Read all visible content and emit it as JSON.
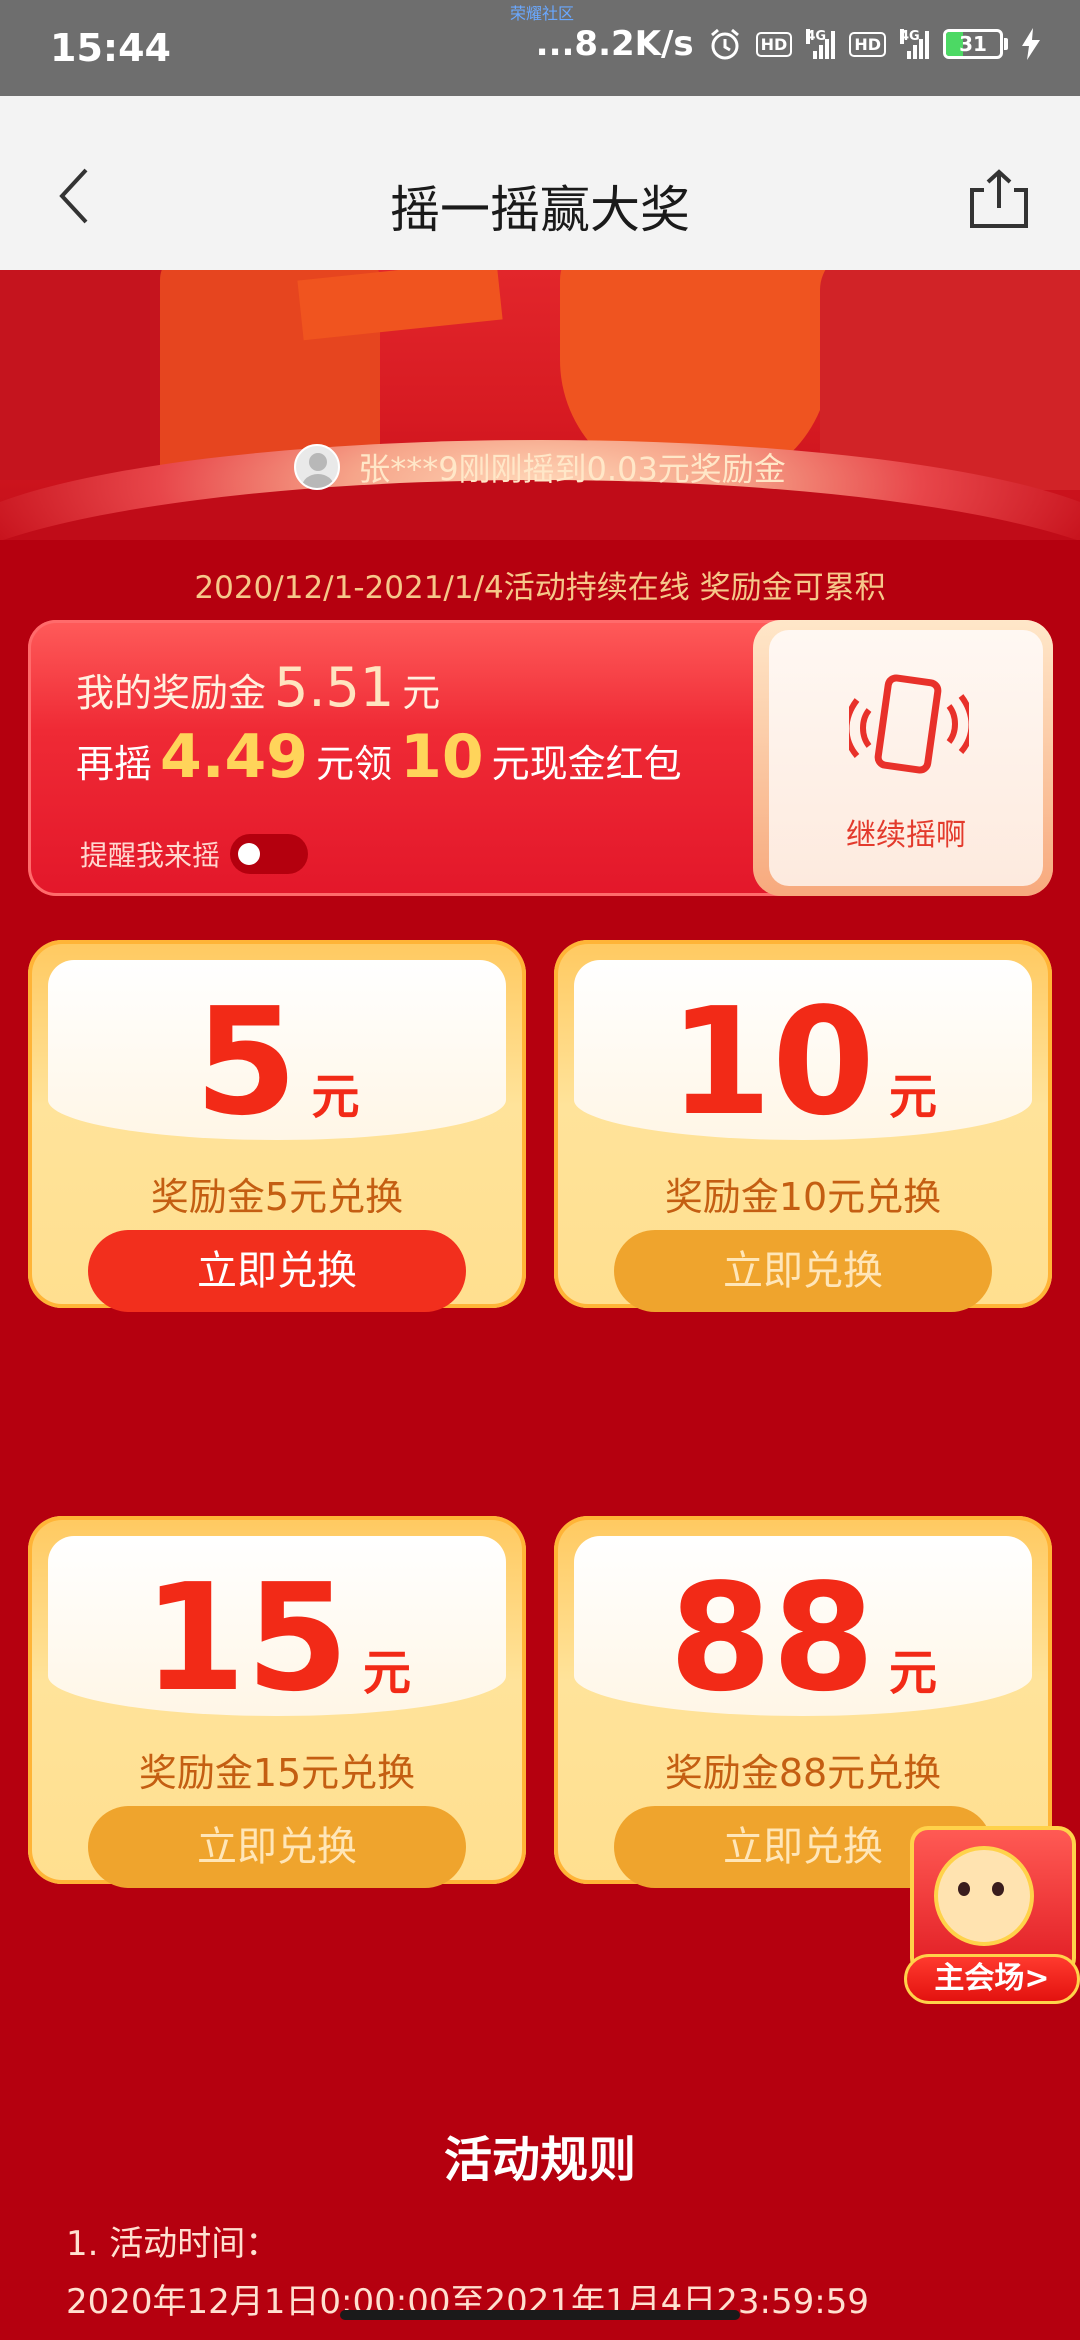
{
  "status_bar": {
    "time": "15:44",
    "tiny_label": "荣耀社区",
    "net_speed": "...8.2K/s",
    "network1": "4G",
    "network2": "4G",
    "hd_label": "HD",
    "battery": "31"
  },
  "header": {
    "title": "摇一摇赢大奖"
  },
  "banner": {
    "winner_text": "张***9刚刚摇到0.03元奖励金"
  },
  "period_text": "2020/12/1-2021/1/4活动持续在线 奖励金可累积",
  "reward": {
    "my_label": "我的奖励金",
    "my_amount": "5.51",
    "my_unit": "元",
    "more_prefix": "再摇",
    "more_amount": "4.49",
    "more_middle": "元领",
    "target_amount": "10",
    "more_suffix": "元现金红包",
    "remind_label": "提醒我来摇",
    "continue_label": "继续摇啊"
  },
  "cards": [
    {
      "amount": "5",
      "unit": "元",
      "desc": "奖励金5元兑换",
      "button": "立即兑换",
      "active": true
    },
    {
      "amount": "10",
      "unit": "元",
      "desc": "奖励金10元兑换",
      "button": "立即兑换",
      "active": false
    },
    {
      "amount": "15",
      "unit": "元",
      "desc": "奖励金15元兑换",
      "button": "立即兑换",
      "active": false
    },
    {
      "amount": "88",
      "unit": "元",
      "desc": "奖励金88元兑换",
      "button": "立即兑换",
      "active": false
    }
  ],
  "rules": {
    "title": "活动规则",
    "item1": "1. 活动时间：",
    "item1_detail": "2020年12月1日0:00:00至2021年1月4日23:59:59"
  },
  "venue_badge": {
    "label": "主会场>"
  },
  "colors": {
    "page_bg": "#b5000f",
    "accent_red": "#f22f1d",
    "gold": "#ffd45a"
  }
}
